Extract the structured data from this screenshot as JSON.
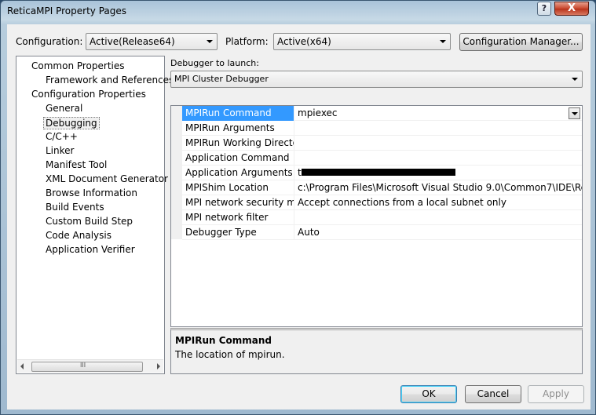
{
  "window": {
    "title": "ReticaMPI Property Pages",
    "close_glyph": "X",
    "help_glyph": "?"
  },
  "top": {
    "configuration_label": "Configuration:",
    "configuration_value": "Active(Release64)",
    "platform_label": "Platform:",
    "platform_value": "Active(x64)",
    "config_manager_label": "Configuration Manager..."
  },
  "tree": {
    "items": [
      {
        "label": "Common Properties",
        "level": 0
      },
      {
        "label": "Framework and References",
        "level": 1
      },
      {
        "label": "Configuration Properties",
        "level": 0
      },
      {
        "label": "General",
        "level": 1
      },
      {
        "label": "Debugging",
        "level": 1,
        "selected": true
      },
      {
        "label": "C/C++",
        "level": 1
      },
      {
        "label": "Linker",
        "level": 1
      },
      {
        "label": "Manifest Tool",
        "level": 1
      },
      {
        "label": "XML Document Generator",
        "level": 1
      },
      {
        "label": "Browse Information",
        "level": 1
      },
      {
        "label": "Build Events",
        "level": 1
      },
      {
        "label": "Custom Build Step",
        "level": 1
      },
      {
        "label": "Code Analysis",
        "level": 1
      },
      {
        "label": "Application Verifier",
        "level": 1
      }
    ],
    "scroll_grip": "III"
  },
  "debugger": {
    "label": "Debugger to launch:",
    "value": "MPI Cluster Debugger"
  },
  "properties": [
    {
      "name": "MPIRun Command",
      "value": "mpiexec"
    },
    {
      "name": "MPIRun Arguments",
      "value": ""
    },
    {
      "name": "MPIRun Working Directory",
      "value": ""
    },
    {
      "name": "Application Command",
      "value": ""
    },
    {
      "name": "Application Arguments",
      "value": "t"
    },
    {
      "name": "MPIShim Location",
      "value": "c:\\Program Files\\Microsoft Visual Studio 9.0\\Common7\\IDE\\Remote"
    },
    {
      "name": "MPI network security mode",
      "value": "Accept connections from a local subnet only"
    },
    {
      "name": "MPI network filter",
      "value": ""
    },
    {
      "name": "Debugger Type",
      "value": "Auto"
    }
  ],
  "description": {
    "title": "MPIRun Command",
    "text": "The location of mpirun."
  },
  "buttons": {
    "ok": "OK",
    "cancel": "Cancel",
    "apply": "Apply"
  }
}
